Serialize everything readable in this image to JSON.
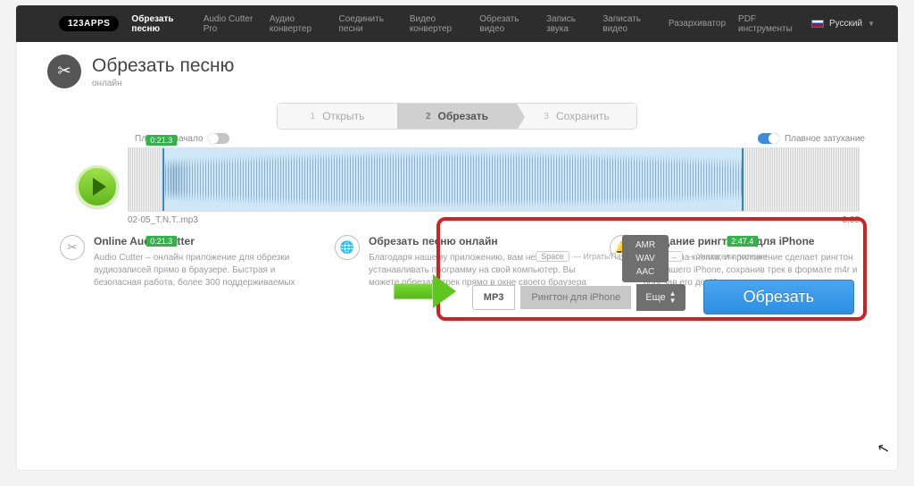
{
  "header": {
    "brand": "123APPS",
    "nav": [
      "Обрезать песню",
      "Audio Cutter Pro",
      "Аудио конвертер",
      "Соединить песни",
      "Видео конвертер",
      "Обрезать видео",
      "Запись звука",
      "Записать видео",
      "Разархиватор",
      "PDF инструменты"
    ],
    "lang": "Русский"
  },
  "title": {
    "main": "Обрезать песню",
    "sub": "онлайн"
  },
  "steps": [
    {
      "n": "1",
      "label": "Открыть"
    },
    {
      "n": "2",
      "label": "Обрезать"
    },
    {
      "n": "3",
      "label": "Сохранить"
    }
  ],
  "fade": {
    "in_label": "Плавное начало",
    "out_label": "Плавное затухание"
  },
  "wave": {
    "filename": "02-05_T.N.T..mp3",
    "total": "3:35",
    "start_tag": "0:21.3",
    "start_below": "0:21.3",
    "end_below": "2:47.4"
  },
  "hints": {
    "space": "Space",
    "play": "Играть/Пауза",
    "arrows": "Указатели позиции",
    "left": "←",
    "right": "→"
  },
  "formats": {
    "mp3": "MP3",
    "ringtone": "Рингтон для iPhone",
    "more": "Еще",
    "popup": [
      "AMR",
      "WAV",
      "AAC"
    ]
  },
  "cut_button": "Обрезать",
  "features": [
    {
      "title": "Online Audio Cutter",
      "body": "Audio Cutter – онлайн приложение для обрезки аудиозаписей прямо в браузере. Быстрая и безопасная работа, более 300 поддерживаемых"
    },
    {
      "title": "Обрезать песню онлайн",
      "body": "Благодаря нашему приложению, вам не нужно устанавливать программу на свой компьютер. Вы можете обрезать трек прямо в окне своего браузера"
    },
    {
      "title": "Создание рингтонов для iPhone",
      "body": "Всего одна кнопка, и приложение сделает рингтон для вашего iPhone, сохранив трек в формате m4r и обрезав его до 40 секунд, после чего вы сможете"
    }
  ]
}
